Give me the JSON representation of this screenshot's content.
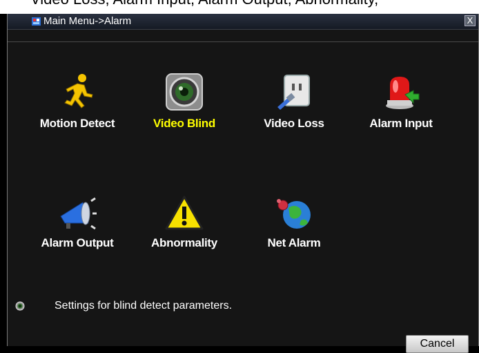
{
  "top_strip": {
    "text": "Video Loss, Alarm Input, Alarm Output, Abnormality,"
  },
  "window": {
    "title": "Main Menu->Alarm",
    "close_label": "X"
  },
  "menu": {
    "selected": "Video Blind",
    "items": [
      {
        "label": "Motion Detect",
        "icon": "running-man-icon"
      },
      {
        "label": "Video Blind",
        "icon": "camera-lens-icon"
      },
      {
        "label": "Video Loss",
        "icon": "unplugged-socket-icon"
      },
      {
        "label": "Alarm Input",
        "icon": "alarm-siren-icon"
      },
      {
        "label": "Alarm Output",
        "icon": "megaphone-icon"
      },
      {
        "label": "Abnormality",
        "icon": "warning-triangle-icon"
      },
      {
        "label": "Net Alarm",
        "icon": "network-globe-icon"
      }
    ]
  },
  "hint": {
    "text": "Settings for blind detect parameters."
  },
  "buttons": {
    "cancel": "Cancel"
  },
  "colors": {
    "background": "#151515",
    "selected_label": "#ffff00",
    "label": "#ffffff"
  }
}
